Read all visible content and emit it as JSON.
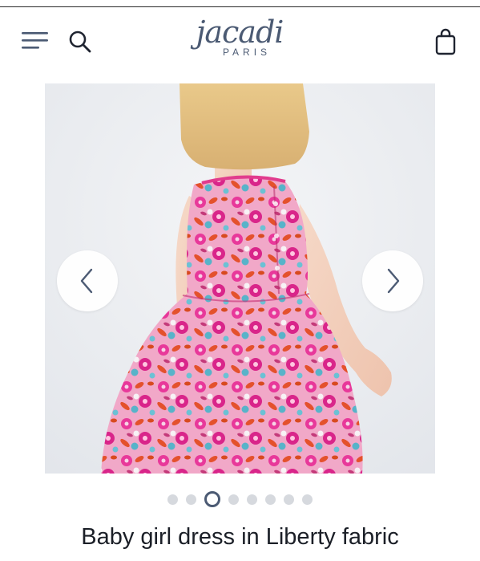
{
  "header": {
    "logo_script": "jacadi",
    "logo_sub": "PARIS",
    "menu_icon": "hamburger-menu-icon",
    "search_icon": "search-icon",
    "bag_icon": "shopping-bag-icon"
  },
  "gallery": {
    "image_count": 8,
    "active_index": 2,
    "prev_icon": "chevron-left-icon",
    "next_icon": "chevron-right-icon"
  },
  "product": {
    "title": "Baby girl dress in Liberty fabric"
  },
  "colors": {
    "brand": "#4b5a73",
    "dot_inactive": "#d6d9de",
    "text": "#1b1f27"
  }
}
